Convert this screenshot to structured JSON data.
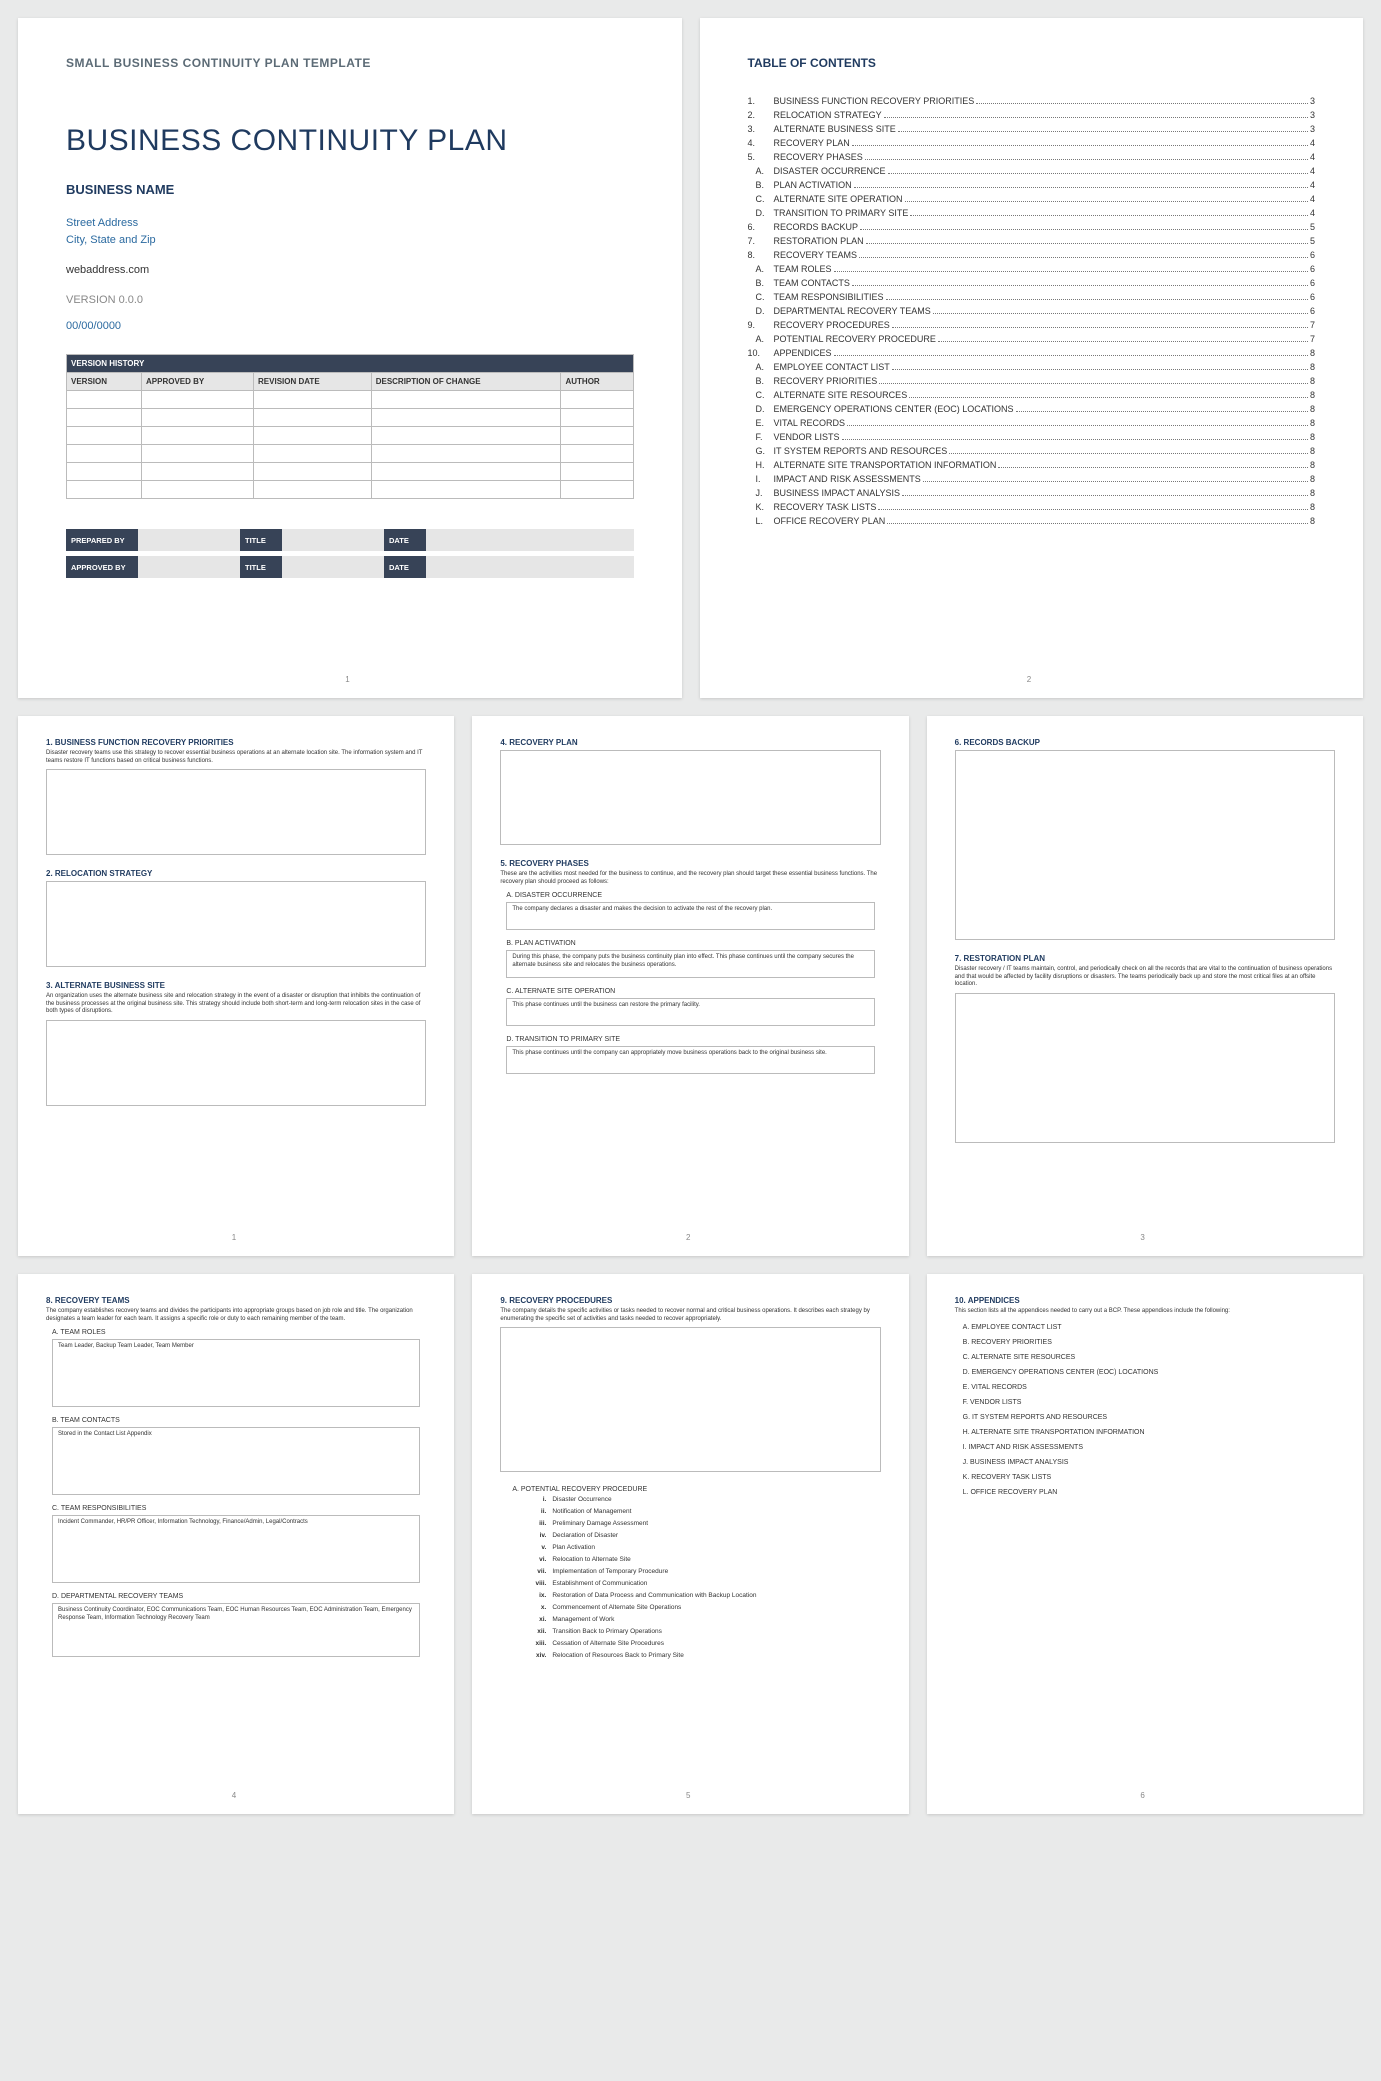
{
  "page1": {
    "template_label": "SMALL BUSINESS CONTINUITY PLAN TEMPLATE",
    "title": "BUSINESS CONTINUITY PLAN",
    "business": "BUSINESS NAME",
    "addr1": "Street Address",
    "addr2": "City, State and Zip",
    "web": "webaddress.com",
    "version": "VERSION 0.0.0",
    "date": "00/00/0000",
    "vh_title": "VERSION HISTORY",
    "vh_headers": [
      "VERSION",
      "APPROVED BY",
      "REVISION DATE",
      "DESCRIPTION OF CHANGE",
      "AUTHOR"
    ],
    "sig": {
      "prepared": "PREPARED BY",
      "approved": "APPROVED BY",
      "title": "TITLE",
      "date": "DATE"
    },
    "pgnum": "1"
  },
  "page2": {
    "title": "TABLE OF CONTENTS",
    "items": [
      {
        "n": "1.",
        "t": "BUSINESS FUNCTION RECOVERY PRIORITIES",
        "p": "3"
      },
      {
        "n": "2.",
        "t": "RELOCATION STRATEGY",
        "p": "3"
      },
      {
        "n": "3.",
        "t": "ALTERNATE BUSINESS SITE",
        "p": "3"
      },
      {
        "n": "4.",
        "t": "RECOVERY PLAN",
        "p": "4"
      },
      {
        "n": "5.",
        "t": "RECOVERY PHASES",
        "p": "4"
      },
      {
        "n": "A.",
        "t": "DISASTER OCCURRENCE",
        "p": "4",
        "s": 1
      },
      {
        "n": "B.",
        "t": "PLAN ACTIVATION",
        "p": "4",
        "s": 1
      },
      {
        "n": "C.",
        "t": "ALTERNATE SITE OPERATION",
        "p": "4",
        "s": 1
      },
      {
        "n": "D.",
        "t": "TRANSITION TO PRIMARY SITE",
        "p": "4",
        "s": 1
      },
      {
        "n": "6.",
        "t": "RECORDS BACKUP",
        "p": "5"
      },
      {
        "n": "7.",
        "t": "RESTORATION PLAN",
        "p": "5"
      },
      {
        "n": "8.",
        "t": "RECOVERY TEAMS",
        "p": "6"
      },
      {
        "n": "A.",
        "t": "TEAM ROLES",
        "p": "6",
        "s": 1
      },
      {
        "n": "B.",
        "t": "TEAM CONTACTS",
        "p": "6",
        "s": 1
      },
      {
        "n": "C.",
        "t": "TEAM RESPONSIBILITIES",
        "p": "6",
        "s": 1
      },
      {
        "n": "D.",
        "t": "DEPARTMENTAL RECOVERY TEAMS",
        "p": "6",
        "s": 1
      },
      {
        "n": "9.",
        "t": "RECOVERY PROCEDURES",
        "p": "7"
      },
      {
        "n": "A.",
        "t": "POTENTIAL RECOVERY PROCEDURE",
        "p": "7",
        "s": 1
      },
      {
        "n": "10.",
        "t": "APPENDICES",
        "p": "8"
      },
      {
        "n": "A.",
        "t": "EMPLOYEE CONTACT LIST",
        "p": "8",
        "s": 1
      },
      {
        "n": "B.",
        "t": "RECOVERY PRIORITIES",
        "p": "8",
        "s": 1
      },
      {
        "n": "C.",
        "t": "ALTERNATE SITE RESOURCES",
        "p": "8",
        "s": 1
      },
      {
        "n": "D.",
        "t": "EMERGENCY OPERATIONS CENTER (EOC) LOCATIONS",
        "p": "8",
        "s": 1
      },
      {
        "n": "E.",
        "t": "VITAL RECORDS",
        "p": "8",
        "s": 1
      },
      {
        "n": "F.",
        "t": "VENDOR LISTS",
        "p": "8",
        "s": 1
      },
      {
        "n": "G.",
        "t": "IT SYSTEM REPORTS AND RESOURCES",
        "p": "8",
        "s": 1
      },
      {
        "n": "H.",
        "t": "ALTERNATE SITE TRANSPORTATION INFORMATION",
        "p": "8",
        "s": 1
      },
      {
        "n": "I.",
        "t": "IMPACT AND RISK ASSESSMENTS",
        "p": "8",
        "s": 1
      },
      {
        "n": "J.",
        "t": "BUSINESS IMPACT ANALYSIS",
        "p": "8",
        "s": 1
      },
      {
        "n": "K.",
        "t": "RECOVERY TASK LISTS",
        "p": "8",
        "s": 1
      },
      {
        "n": "L.",
        "t": "OFFICE RECOVERY PLAN",
        "p": "8",
        "s": 1
      }
    ],
    "pgnum": "2"
  },
  "page3": {
    "h1": "1. BUSINESS FUNCTION RECOVERY PRIORITIES",
    "d1": "Disaster recovery teams use this strategy to recover essential business operations at an alternate location site. The information system and IT teams restore IT functions based on critical business functions.",
    "h2": "2. RELOCATION STRATEGY",
    "h3": "3. ALTERNATE BUSINESS SITE",
    "d3": "An organization uses the alternate business site and relocation strategy in the event of a disaster or disruption that inhibits the continuation of the business processes at the original business site. This strategy should include both short-term and long-term relocation sites in the case of both types of disruptions.",
    "pgnum": "1"
  },
  "page4": {
    "h4": "4. RECOVERY PLAN",
    "h5": "5. RECOVERY PHASES",
    "d5": "These are the activities most needed for the business to continue, and the recovery plan should target these essential business functions. The recovery plan should proceed as follows:",
    "a_h": "A. DISASTER OCCURRENCE",
    "a_t": "The company declares a disaster and makes the decision to activate the rest of the recovery plan.",
    "b_h": "B. PLAN ACTIVATION",
    "b_t": "During this phase, the company puts the business continuity plan into effect. This phase continues until the company secures the alternate business site and relocates the business operations.",
    "c_h": "C. ALTERNATE SITE OPERATION",
    "c_t": "This phase continues until the business can restore the primary facility.",
    "d_h": "D. TRANSITION TO PRIMARY SITE",
    "d_t": "This phase continues until the company can appropriately move business operations back to the original business site.",
    "pgnum": "2"
  },
  "page5": {
    "h6": "6. RECORDS BACKUP",
    "h7": "7. RESTORATION PLAN",
    "d7": "Disaster recovery / IT teams maintain, control, and periodically check on all the records that are vital to the continuation of business operations and that would be affected by facility disruptions or disasters. The teams periodically back up and store the most critical files at an offsite location.",
    "pgnum": "3"
  },
  "page6": {
    "h8": "8. RECOVERY TEAMS",
    "d8": "The company establishes recovery teams and divides the participants into appropriate groups based on job role and title. The organization designates a team leader for each team. It assigns a specific role or duty to each remaining member of the team.",
    "a_h": "A. TEAM ROLES",
    "a_t": "Team Leader, Backup Team Leader, Team Member",
    "b_h": "B. TEAM CONTACTS",
    "b_t": "Stored in the Contact List Appendix",
    "c_h": "C. TEAM RESPONSIBILITIES",
    "c_t": "Incident Commander, HR/PR Officer, Information Technology, Finance/Admin, Legal/Contracts",
    "d_h": "D. DEPARTMENTAL RECOVERY TEAMS",
    "d_t": "Business Continuity Coordinator, EOC Communications Team, EOC Human Resources Team, EOC Administration Team, Emergency Response Team, Information Technology Recovery Team",
    "pgnum": "4"
  },
  "page7": {
    "h9": "9. RECOVERY PROCEDURES",
    "d9": "The company details the specific activities or tasks needed to recover normal and critical business operations. It describes each strategy by enumerating the specific set of activities and tasks needed to recover appropriately.",
    "a_h": "A. POTENTIAL RECOVERY PROCEDURE",
    "steps": [
      {
        "n": "i.",
        "t": "Disaster Occurrence"
      },
      {
        "n": "ii.",
        "t": "Notification of Management"
      },
      {
        "n": "iii.",
        "t": "Preliminary Damage Assessment"
      },
      {
        "n": "iv.",
        "t": "Declaration of Disaster"
      },
      {
        "n": "v.",
        "t": "Plan Activation"
      },
      {
        "n": "vi.",
        "t": "Relocation to Alternate Site"
      },
      {
        "n": "vii.",
        "t": "Implementation of Temporary Procedure"
      },
      {
        "n": "viii.",
        "t": "Establishment of Communication"
      },
      {
        "n": "ix.",
        "t": "Restoration of Data Process and Communication with Backup Location"
      },
      {
        "n": "x.",
        "t": "Commencement of Alternate Site Operations"
      },
      {
        "n": "xi.",
        "t": "Management of Work"
      },
      {
        "n": "xii.",
        "t": "Transition Back to Primary Operations"
      },
      {
        "n": "xiii.",
        "t": "Cessation of Alternate Site Procedures"
      },
      {
        "n": "xiv.",
        "t": "Relocation of Resources Back to Primary Site"
      }
    ],
    "pgnum": "5"
  },
  "page8": {
    "h10": "10.   APPENDICES",
    "d10": "This section lists all the appendices needed to carry out a BCP. These appendices include the following:",
    "items": [
      "A. EMPLOYEE CONTACT LIST",
      "B. RECOVERY PRIORITIES",
      "C. ALTERNATE SITE RESOURCES",
      "D. EMERGENCY OPERATIONS CENTER (EOC) LOCATIONS",
      "E. VITAL RECORDS",
      "F. VENDOR LISTS",
      "G. IT SYSTEM REPORTS AND RESOURCES",
      "H. ALTERNATE SITE TRANSPORTATION INFORMATION",
      "I. IMPACT AND RISK ASSESSMENTS",
      "J. BUSINESS IMPACT ANALYSIS",
      "K. RECOVERY TASK LISTS",
      "L. OFFICE RECOVERY PLAN"
    ],
    "pgnum": "6"
  }
}
